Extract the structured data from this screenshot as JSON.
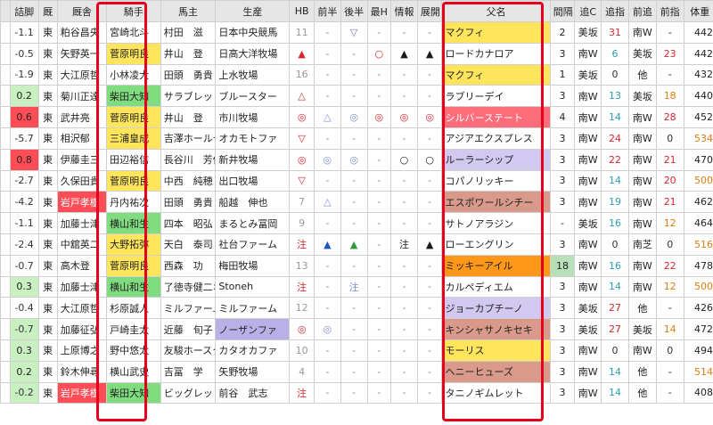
{
  "headers": [
    "詰脚",
    "厩",
    "厩舎",
    "騎手",
    "馬主",
    "生産",
    "HB",
    "前半",
    "後半",
    "最H",
    "情報",
    "展開",
    "父名",
    "間隔",
    "追C",
    "追指",
    "前追",
    "前指",
    "体重"
  ],
  "colors": {
    "green_bg": "#7fdc7f",
    "red_bg": "#ff4d57",
    "purple_bg": "#b9b0e8",
    "yellow_bg": "#ffe55c",
    "mauve_bg": "#d99a8c",
    "orange_bg": "#ff9818",
    "lavender_bg": "#d2c9f0",
    "light_green": "#c9f0c0",
    "pink_bg": "#ff6d7a"
  },
  "rows": [
    {
      "mark": "",
      "tsumeashi": "-1.1",
      "zoku": "東",
      "stable": "粕谷昌央",
      "jockey": "宮崎北斗",
      "owner": "村田　滋",
      "breeder": "日本中央競馬",
      "hb": "11",
      "zenhan": "-",
      "kohan": "▽",
      "saiH": "-",
      "joho": "-",
      "tenkai": "-",
      "sire": "マクフィ",
      "kankaku": "2",
      "oiC": "美坂",
      "oishi": "31",
      "maeoi": "南W",
      "maeshi": "-",
      "weight": "442"
    },
    {
      "mark": "",
      "tsumeashi": "-0.5",
      "zoku": "東",
      "stable": "矢野英一",
      "jockey": "菅原明良",
      "owner": "井山　登",
      "breeder": "日高大洋牧場",
      "hb": "▲",
      "zenhan": "-",
      "kohan": "-",
      "saiH": "○",
      "joho": "▲",
      "tenkai": "▲",
      "sire": "ロードカナロア",
      "kankaku": "3",
      "oiC": "南W",
      "oishi": "6",
      "maeoi": "美坂",
      "maeshi": "23",
      "weight": "442"
    },
    {
      "mark": "",
      "tsumeashi": "-1.9",
      "zoku": "東",
      "stable": "大江原哲",
      "jockey": "小林凌大",
      "owner": "田頭　勇貴",
      "breeder": "上水牧場",
      "hb": "16",
      "zenhan": "-",
      "kohan": "-",
      "saiH": "-",
      "joho": "-",
      "tenkai": "-",
      "sire": "マクフィ",
      "kankaku": "1",
      "oiC": "美坂",
      "oishi": "0",
      "maeoi": "他",
      "maeshi": "-",
      "weight": "432"
    },
    {
      "mark": "",
      "tsumeashi": "0.2",
      "zoku": "東",
      "stable": "菊川正達",
      "jockey": "柴田大知",
      "owner": "サラブレッド",
      "breeder": "ブルースター",
      "hb": "△",
      "zenhan": "-",
      "kohan": "-",
      "saiH": "-",
      "joho": "-",
      "tenkai": "-",
      "sire": "ラブリーデイ",
      "kankaku": "3",
      "oiC": "南W",
      "oishi": "13",
      "maeoi": "美坂",
      "maeshi": "18",
      "weight": "440"
    },
    {
      "mark": "",
      "tsumeashi": "0.6",
      "zoku": "東",
      "stable": "武井亮",
      "jockey": "菅原明良",
      "owner": "井山　登",
      "breeder": "市川牧場",
      "hb": "◎",
      "zenhan": "△",
      "kohan": "◎",
      "saiH": "◎",
      "joho": "◎",
      "tenkai": "◎",
      "sire": "シルバーステート",
      "kankaku": "4",
      "oiC": "南W",
      "oishi": "14",
      "maeoi": "南W",
      "maeshi": "28",
      "weight": "452"
    },
    {
      "mark": "",
      "tsumeashi": "-5.7",
      "zoku": "東",
      "stable": "相沢郁",
      "jockey": "三浦皇成",
      "owner": "吉澤ホールデ",
      "breeder": "オカモトファ",
      "hb": "▽",
      "zenhan": "-",
      "kohan": "-",
      "saiH": "-",
      "joho": "-",
      "tenkai": "-",
      "sire": "アジアエクスプレス",
      "kankaku": "3",
      "oiC": "南W",
      "oishi": "24",
      "maeoi": "南W",
      "maeshi": "0",
      "weight": "534"
    },
    {
      "mark": "",
      "tsumeashi": "0.8",
      "zoku": "東",
      "stable": "伊藤圭三",
      "jockey": "田辺裕信",
      "owner": "長谷川　芳信",
      "breeder": "新井牧場",
      "hb": "◎",
      "zenhan": "◎",
      "kohan": "◎",
      "saiH": "-",
      "joho": "○",
      "tenkai": "○",
      "sire": "ルーラーシップ",
      "kankaku": "3",
      "oiC": "南W",
      "oishi": "22",
      "maeoi": "南W",
      "maeshi": "21",
      "weight": "470"
    },
    {
      "mark": "",
      "tsumeashi": "-2.7",
      "zoku": "東",
      "stable": "久保田貴",
      "jockey": "菅原明良",
      "owner": "中西　純穂",
      "breeder": "出口牧場",
      "hb": "▽",
      "zenhan": "-",
      "kohan": "-",
      "saiH": "-",
      "joho": "-",
      "tenkai": "-",
      "sire": "コパノリッキー",
      "kankaku": "3",
      "oiC": "南W",
      "oishi": "14",
      "maeoi": "南W",
      "maeshi": "20",
      "weight": "500"
    },
    {
      "mark": "",
      "tsumeashi": "-4.2",
      "zoku": "東",
      "stable": "岩戸孝樹",
      "jockey": "丹内祐次",
      "owner": "田頭　勇貴",
      "breeder": "船越　伸也",
      "hb": "7",
      "zenhan": "△",
      "kohan": "-",
      "saiH": "-",
      "joho": "-",
      "tenkai": "-",
      "sire": "エスポワールシチー",
      "kankaku": "3",
      "oiC": "南W",
      "oishi": "19",
      "maeoi": "南W",
      "maeshi": "21",
      "weight": "462"
    },
    {
      "mark": "",
      "tsumeashi": "-1.1",
      "zoku": "東",
      "stable": "加藤士津",
      "jockey": "横山和生",
      "owner": "四本　昭弘",
      "breeder": "まるとみ冨岡",
      "hb": "9",
      "zenhan": "-",
      "kohan": "-",
      "saiH": "-",
      "joho": "-",
      "tenkai": "-",
      "sire": "サトノアラジン",
      "kankaku": "-",
      "oiC": "美坂",
      "oishi": "16",
      "maeoi": "南W",
      "maeshi": "12",
      "weight": "464"
    },
    {
      "mark": "",
      "tsumeashi": "-2.4",
      "zoku": "東",
      "stable": "中舘英二",
      "jockey": "大野拓弥",
      "owner": "天白　泰司",
      "breeder": "社台ファーム",
      "hb": "注",
      "zenhan": "▲",
      "kohan": "▲",
      "saiH": "-",
      "joho": "注",
      "tenkai": "▲",
      "sire": "ローエングリン",
      "kankaku": "3",
      "oiC": "南W",
      "oishi": "0",
      "maeoi": "南芝",
      "maeshi": "0",
      "weight": "516"
    },
    {
      "mark": "",
      "tsumeashi": "-0.7",
      "zoku": "東",
      "stable": "高木登",
      "jockey": "菅原明良",
      "owner": "西森　功",
      "breeder": "梅田牧場",
      "hb": "13",
      "zenhan": "-",
      "kohan": "-",
      "saiH": "-",
      "joho": "-",
      "tenkai": "-",
      "sire": "ミッキーアイル",
      "kankaku": "18",
      "oiC": "南W",
      "oishi": "16",
      "maeoi": "南W",
      "maeshi": "22",
      "weight": "478"
    },
    {
      "mark": "",
      "tsumeashi": "0.3",
      "zoku": "東",
      "stable": "加藤士津",
      "jockey": "横山和生",
      "owner": "了徳寺健二ホ",
      "breeder": "Stoneh",
      "hb": "注",
      "zenhan": "-",
      "kohan": "注",
      "saiH": "-",
      "joho": "-",
      "tenkai": "-",
      "sire": "カルペディエム",
      "kankaku": "3",
      "oiC": "南W",
      "oishi": "14",
      "maeoi": "南W",
      "maeshi": "12",
      "weight": "500"
    },
    {
      "mark": "",
      "tsumeashi": "-0.4",
      "zoku": "東",
      "stable": "大江原哲",
      "jockey": "杉原誠人",
      "owner": "ミルファーム",
      "breeder": "ミルファーム",
      "hb": "12",
      "zenhan": "-",
      "kohan": "-",
      "saiH": "-",
      "joho": "-",
      "tenkai": "-",
      "sire": "ジョーカプチーノ",
      "kankaku": "3",
      "oiC": "美坂",
      "oishi": "27",
      "maeoi": "他",
      "maeshi": "-",
      "weight": "426"
    },
    {
      "mark": "",
      "tsumeashi": "-0.7",
      "zoku": "東",
      "stable": "加藤征弘",
      "jockey": "戸崎圭太",
      "owner": "近藤　旬子",
      "breeder": "ノーザンファ",
      "hb": "◎",
      "zenhan": "◎",
      "kohan": "-",
      "saiH": "-",
      "joho": "-",
      "tenkai": "-",
      "sire": "キンシャサノキセキ",
      "kankaku": "3",
      "oiC": "美坂",
      "oishi": "27",
      "maeoi": "美坂",
      "maeshi": "14",
      "weight": "472"
    },
    {
      "mark": "",
      "tsumeashi": "0.3",
      "zoku": "東",
      "stable": "上原博之",
      "jockey": "野中悠太",
      "owner": "友駿ホースク",
      "breeder": "カタオカファ",
      "hb": "10",
      "zenhan": "-",
      "kohan": "-",
      "saiH": "-",
      "joho": "-",
      "tenkai": "-",
      "sire": "モーリス",
      "kankaku": "3",
      "oiC": "南W",
      "oishi": "0",
      "maeoi": "南W",
      "maeshi": "0",
      "weight": "494"
    },
    {
      "mark": "",
      "tsumeashi": "0.2",
      "zoku": "東",
      "stable": "鈴木伸尋",
      "jockey": "横山武史",
      "owner": "吉冨　学",
      "breeder": "矢野牧場",
      "hb": "4",
      "zenhan": "-",
      "kohan": "-",
      "saiH": "-",
      "joho": "-",
      "tenkai": "-",
      "sire": "ヘニーヒューズ",
      "kankaku": "3",
      "oiC": "南W",
      "oishi": "14",
      "maeoi": "他",
      "maeshi": "-",
      "weight": "514"
    },
    {
      "mark": "",
      "tsumeashi": "-0.2",
      "zoku": "東",
      "stable": "岩戸孝樹",
      "jockey": "柴田大知",
      "owner": "ビッグレッド",
      "breeder": "前谷　武志",
      "hb": "注",
      "zenhan": "-",
      "kohan": "-",
      "saiH": "-",
      "joho": "-",
      "tenkai": "-",
      "sire": "タニノギムレット",
      "kankaku": "3",
      "oiC": "南W",
      "oishi": "14",
      "maeoi": "他",
      "maeshi": "-",
      "weight": "408"
    }
  ]
}
